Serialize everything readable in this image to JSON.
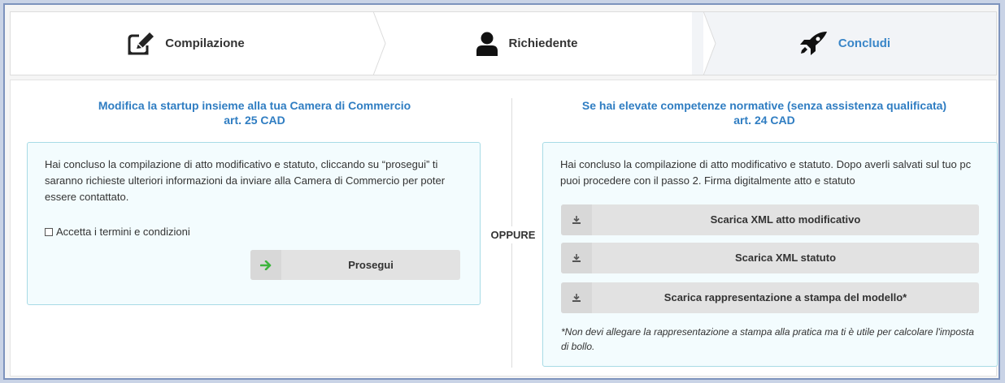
{
  "wizard": {
    "steps": [
      {
        "label": "Compilazione",
        "icon": "edit-icon",
        "active": false
      },
      {
        "label": "Richiedente",
        "icon": "user-icon",
        "active": false
      },
      {
        "label": "Concludi",
        "icon": "rocket-icon",
        "active": true
      }
    ]
  },
  "left": {
    "title_line1": "Modifica la startup insieme alla tua Camera di Commercio",
    "title_line2": "art. 25 CAD",
    "text": "Hai concluso la compilazione di atto modificativo e statuto, cliccando su “prosegui” ti saranno richieste ulteriori informazioni da inviare alla Camera di Commercio per poter essere contattato.",
    "checkbox_label": "Accetta i termini e condizioni",
    "proceed_label": "Prosegui"
  },
  "separator": "OPPURE",
  "right": {
    "title_line1": "Se hai elevate competenze normative (senza assistenza qualificata)",
    "title_line2": "art. 24 CAD",
    "text": "Hai concluso la compilazione di atto modificativo e statuto. Dopo averli salvati sul tuo pc puoi procedere con il passo 2. Firma digitalmente atto e statuto",
    "buttons": [
      {
        "label": "Scarica XML atto modificativo",
        "icon": "download-icon"
      },
      {
        "label": "Scarica XML statuto",
        "icon": "download-icon"
      },
      {
        "label": "Scarica rappresentazione a stampa del modello*",
        "icon": "download-icon"
      }
    ],
    "note": "*Non devi allegare la rappresentazione a stampa alla pratica ma ti è utile per calcolare l'imposta di bollo."
  },
  "colors": {
    "accent": "#2f7dc2",
    "panel_bg": "#f3fcfe",
    "panel_border": "#a8dbe6",
    "button_bg": "#e2e2e2",
    "arrow_green": "#3cb43c"
  }
}
